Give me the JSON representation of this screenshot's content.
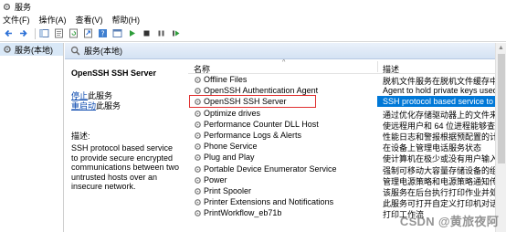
{
  "window": {
    "title": "服务",
    "icon": "gear-icon"
  },
  "menu": [
    "文件(F)",
    "操作(A)",
    "查看(V)",
    "帮助(H)"
  ],
  "toolbar": {
    "icons": [
      "back-arrow-icon",
      "forward-arrow-icon",
      "console-tree-icon",
      "properties-icon",
      "refresh-icon",
      "export-icon",
      "help-icon",
      "console-icon",
      "play-icon",
      "stop-icon",
      "pause-icon",
      "restart-icon"
    ]
  },
  "tree": {
    "root_label": "服务(本地)"
  },
  "main": {
    "header_label": "服务(本地)"
  },
  "details": {
    "service_title": "OpenSSH SSH Server",
    "stop_link": "停止",
    "stop_suffix": "此服务",
    "restart_link": "重启动",
    "restart_suffix": "此服务",
    "description_label": "描述:",
    "description_text": "SSH protocol based service to provide secure encrypted communications between two untrusted hosts over an insecure network."
  },
  "columns": {
    "name": "名称",
    "description": "描述"
  },
  "services": [
    {
      "name": "Offline Files",
      "description": "脱机文件服务在脱机文件缓存中执行维护"
    },
    {
      "name": "OpenSSH Authentication Agent",
      "description": "Agent to hold private keys used for p"
    },
    {
      "name": "OpenSSH SSH Server",
      "description": "SSH protocol based service to provide",
      "selected": true
    },
    {
      "name": "Optimize drives",
      "description": "通过优化存储驱动器上的文件来帮助计"
    },
    {
      "name": "Performance Counter DLL Host",
      "description": "使远程用户和 64 位进程能够查询 32 位"
    },
    {
      "name": "Performance Logs & Alerts",
      "description": "性能日志和警报根据预配置的计划参数从"
    },
    {
      "name": "Phone Service",
      "description": "在设备上管理电话服务状态"
    },
    {
      "name": "Plug and Play",
      "description": "使计算机在极少或没有用户输入的情况下"
    },
    {
      "name": "Portable Device Enumerator Service",
      "description": "强制可移动大容量存储设备的组策略。使"
    },
    {
      "name": "Power",
      "description": "管理电源策略和电源策略通知传递。"
    },
    {
      "name": "Print Spooler",
      "description": "该服务在后台执行打印作业并处理与打印"
    },
    {
      "name": "Printer Extensions and Notifications",
      "description": "此服务可打开自定义打印机对话框"
    },
    {
      "name": "PrintWorkflow_eb71b",
      "description": "打印工作流"
    }
  ],
  "watermark": "CSDN @黄旅夜阿",
  "colors": {
    "selected_bg": "#0078d7",
    "highlight_box": "#e03030",
    "link": "#0645ad",
    "header_bg": "#dbe6f4"
  }
}
